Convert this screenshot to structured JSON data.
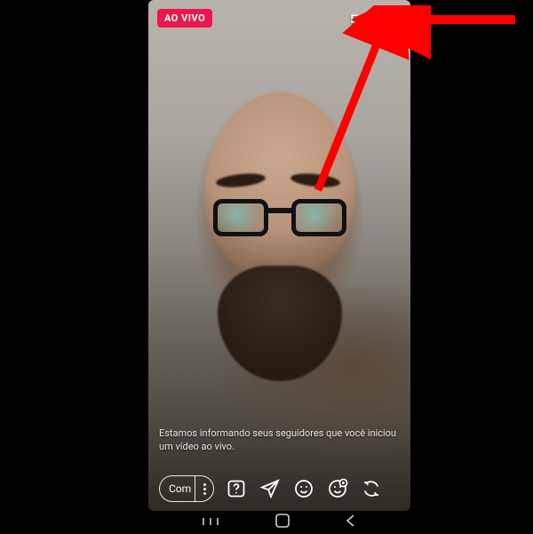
{
  "live_badge": "AO VIVO",
  "end_button": "Encerrar",
  "info_text": "Estamos informando seus seguidores que você iniciou um vídeo ao vivo.",
  "comment_placeholder": "Com",
  "icons": {
    "question": "question-icon",
    "send": "send-icon",
    "face_filter": "face-filter-icon",
    "add_guest": "add-guest-icon",
    "switch_camera": "switch-camera-icon"
  },
  "colors": {
    "live_badge_bg": "#ed164f",
    "arrow": "#ff0000"
  }
}
